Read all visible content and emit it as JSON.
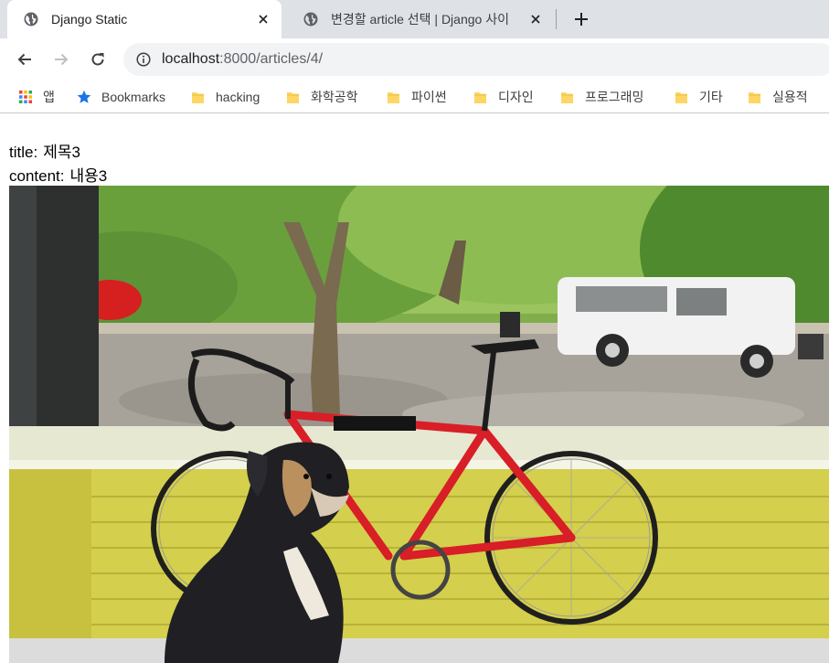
{
  "browser": {
    "tabs": [
      {
        "title": "Django Static",
        "active": true,
        "icon": "globe-icon"
      },
      {
        "title": "변경할 article 선택 | Django 사이",
        "active": false,
        "icon": "globe-icon"
      }
    ],
    "new_tab_icon": "plus-icon",
    "close_icon": "close-icon",
    "address": {
      "host": "localhost",
      "rest": ":8000/articles/4/",
      "info_icon": "info-icon"
    },
    "bookmarks": [
      {
        "label": "앱",
        "icon": "apps-grid-icon"
      },
      {
        "label": "Bookmarks",
        "icon": "star-icon"
      },
      {
        "label": "hacking",
        "icon": "folder-icon"
      },
      {
        "label": "화학공학",
        "icon": "folder-icon"
      },
      {
        "label": "파이썬",
        "icon": "folder-icon"
      },
      {
        "label": "디자인",
        "icon": "folder-icon"
      },
      {
        "label": "프로그래밍",
        "icon": "folder-icon"
      },
      {
        "label": "기타",
        "icon": "folder-icon"
      },
      {
        "label": "실용적",
        "icon": "folder-icon"
      }
    ]
  },
  "article": {
    "title_key": "title:",
    "title": "제목3",
    "content_key": "content:",
    "content": "내용3",
    "image": "photo-dog-bicycle-porch"
  },
  "colors": {
    "tabstrip": "#dee1e6",
    "omnibox": "#f1f3f4",
    "folder": "#fdd663",
    "star": "#1a73e8"
  }
}
